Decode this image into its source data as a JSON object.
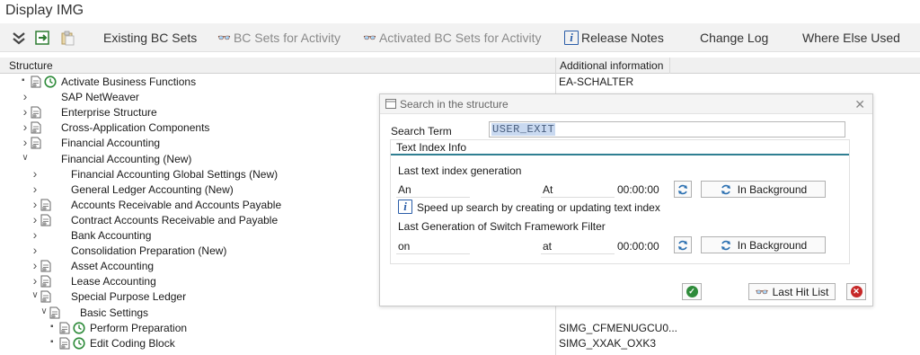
{
  "window": {
    "title": "Display IMG"
  },
  "toolbar": {
    "existing_bc_sets": "Existing BC Sets",
    "bc_sets_for_activity": "BC Sets for Activity",
    "activated_bc_sets": "Activated BC Sets for Activity",
    "release_notes": "Release Notes",
    "change_log": "Change Log",
    "where_else_used": "Where Else Used"
  },
  "table": {
    "col_structure": "Structure",
    "col_additional_info": "Additional information"
  },
  "tree": [
    {
      "label": "Activate Business Functions",
      "info": "EA-SCHALTER"
    },
    {
      "label": "SAP NetWeaver",
      "info": ""
    },
    {
      "label": "Enterprise Structure",
      "info": ""
    },
    {
      "label": "Cross-Application Components",
      "info": ""
    },
    {
      "label": "Financial Accounting",
      "info": ""
    },
    {
      "label": "Financial Accounting (New)",
      "info": ""
    },
    {
      "label": "Financial Accounting Global Settings (New)",
      "info": ""
    },
    {
      "label": "General Ledger Accounting (New)",
      "info": ""
    },
    {
      "label": "Accounts Receivable and Accounts Payable",
      "info": ""
    },
    {
      "label": "Contract Accounts Receivable and Payable",
      "info": ""
    },
    {
      "label": "Bank Accounting",
      "info": ""
    },
    {
      "label": "Consolidation Preparation (New)",
      "info": ""
    },
    {
      "label": "Asset Accounting",
      "info": ""
    },
    {
      "label": "Lease Accounting",
      "info": ""
    },
    {
      "label": "Special Purpose Ledger",
      "info": ""
    },
    {
      "label": "Basic Settings",
      "info": ""
    },
    {
      "label": "Perform Preparation",
      "info": "SIMG_CFMENUGCU0..."
    },
    {
      "label": "Edit Coding Block",
      "info": "SIMG_XXAK_OXK3"
    }
  ],
  "dialog": {
    "title": "Search in the structure",
    "search_term_label": "Search Term",
    "search_term_value": "USER_EXIT",
    "group_title": "Text Index Info",
    "last_text_index_label": "Last text index generation",
    "row1": {
      "on_label": "An",
      "at_label": "At",
      "time": "00:00:00"
    },
    "hint": "Speed up search by creating or updating text index",
    "last_switch_label": "Last Generation of Switch Framework Filter",
    "row2": {
      "on_label": "on",
      "at_label": "at",
      "time": "00:00:00"
    },
    "in_background": "In Background",
    "last_hit_list": "Last Hit List"
  }
}
